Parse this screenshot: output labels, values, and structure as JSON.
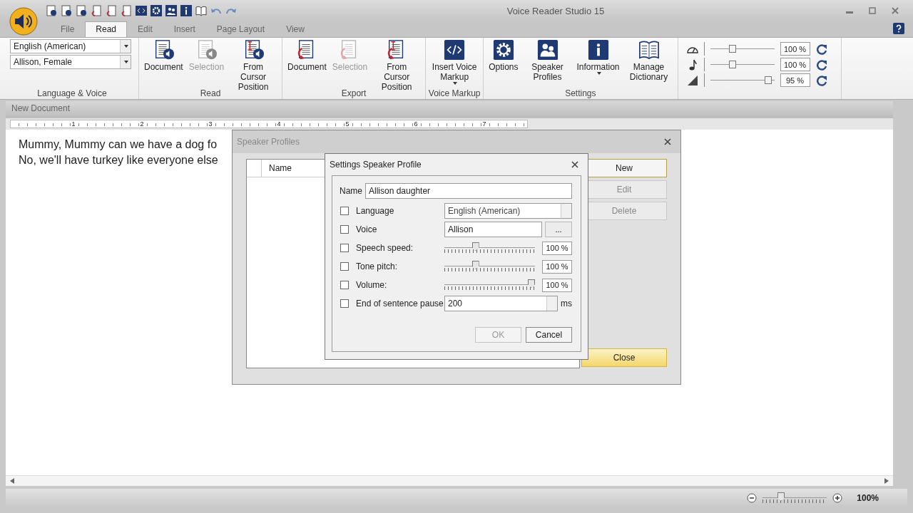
{
  "window": {
    "title": "Voice Reader Studio 15"
  },
  "tabs": [
    {
      "label": "File",
      "selected": false
    },
    {
      "label": "Read",
      "selected": true
    },
    {
      "label": "Edit",
      "selected": false
    },
    {
      "label": "Insert",
      "selected": false
    },
    {
      "label": "Page Layout",
      "selected": false
    },
    {
      "label": "View",
      "selected": false
    }
  ],
  "ribbon": {
    "groups": [
      {
        "label": "Language & Voice",
        "kind": "combos",
        "combos": [
          {
            "value": "English (American)"
          },
          {
            "value": "Allison, Female"
          }
        ]
      },
      {
        "label": "Read",
        "kind": "buttons",
        "buttons": [
          {
            "label": "Document",
            "kind": "speakdoc",
            "disabled": false
          },
          {
            "label": "Selection",
            "kind": "speakdoc",
            "disabled": true
          },
          {
            "label": "From Cursor Position",
            "kind": "speakcursor",
            "disabled": false
          }
        ]
      },
      {
        "label": "Export",
        "kind": "buttons",
        "buttons": [
          {
            "label": "Document",
            "kind": "savedoc",
            "disabled": false
          },
          {
            "label": "Selection",
            "kind": "savedoc",
            "disabled": true
          },
          {
            "label": "From Cursor Position",
            "kind": "savecursor",
            "disabled": false
          }
        ]
      },
      {
        "label": "Voice Markup",
        "kind": "buttons",
        "buttons": [
          {
            "label": "Insert Voice Markup",
            "kind": "markup",
            "disabled": false,
            "dropdown": true
          }
        ]
      },
      {
        "label": "Settings",
        "kind": "buttons",
        "buttons": [
          {
            "label": "Options",
            "kind": "gear",
            "disabled": false
          },
          {
            "label": "Speaker Profiles",
            "kind": "people",
            "disabled": false
          },
          {
            "label": "Information",
            "kind": "info",
            "disabled": false,
            "dropdown": true
          },
          {
            "label": "Manage Dictionary",
            "kind": "book",
            "disabled": false
          }
        ]
      },
      {
        "kind": "sliders",
        "sliders": [
          {
            "kind": "speed",
            "level": 0.33,
            "reading": "100 %"
          },
          {
            "kind": "pitch",
            "level": 0.33,
            "reading": "100 %"
          },
          {
            "kind": "volume",
            "level": 0.95,
            "reading": "95 %"
          }
        ]
      }
    ]
  },
  "document": {
    "title": "New Document",
    "ruler": [
      "1",
      "2",
      "3",
      "4",
      "5",
      "6",
      "7"
    ],
    "lines": [
      "Mummy, Mummy can we have a dog fo",
      "No, we'll have turkey like everyone else"
    ]
  },
  "speaker_profiles": {
    "title": "Speaker Profiles",
    "columns": [
      "Name"
    ],
    "buttons": [
      {
        "label": "New",
        "kind": "default",
        "disabled": false
      },
      {
        "label": "Edit",
        "kind": "normal",
        "disabled": true
      },
      {
        "label": "Delete",
        "kind": "normal",
        "disabled": true
      },
      {
        "label": "Close",
        "kind": "hot",
        "disabled": false
      }
    ]
  },
  "settings_dialog": {
    "title": "Settings Speaker Profile",
    "name_label": "Name",
    "name_value": "Allison daughter",
    "rows": [
      {
        "kind": "combo",
        "label": "Language",
        "checked": false,
        "value": "English (American)"
      },
      {
        "kind": "text",
        "label": "Voice",
        "checked": false,
        "value": "Allison",
        "button": "..."
      },
      {
        "kind": "slider",
        "label": "Speech speed:",
        "checked": false,
        "level": 0.33,
        "reading": "100 %"
      },
      {
        "kind": "slider",
        "label": "Tone pitch:",
        "checked": false,
        "level": 0.33,
        "reading": "100 %"
      },
      {
        "kind": "slider",
        "label": "Volume:",
        "checked": false,
        "level": 1,
        "reading": "100 %"
      },
      {
        "kind": "spin",
        "label": "End of sentence pause",
        "checked": false,
        "value": "200",
        "unit": "ms"
      }
    ],
    "buttons": [
      {
        "label": "OK",
        "disabled": true
      },
      {
        "label": "Cancel",
        "disabled": false
      }
    ]
  },
  "status_bar": {
    "zoom": {
      "level": 0.26,
      "reading": "100%"
    }
  }
}
